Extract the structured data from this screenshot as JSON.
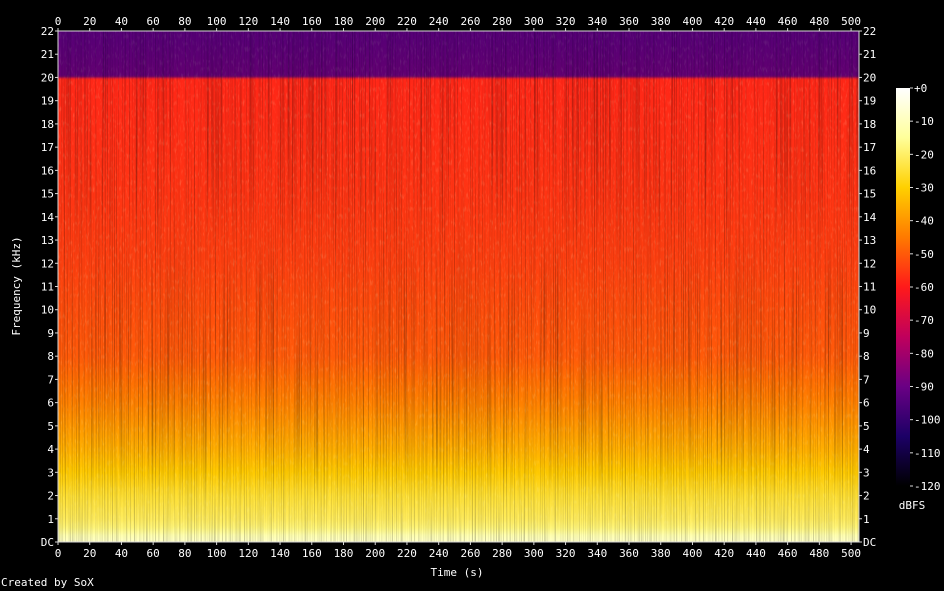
{
  "footer": "Created by SoX",
  "chart_data": {
    "type": "heatmap",
    "title": "",
    "xlabel": "Time (s)",
    "ylabel": "Frequency (kHz)",
    "colorbar_label": "dBFS",
    "xlim": [
      0,
      505
    ],
    "ylim": [
      0,
      22
    ],
    "x_ticks": [
      "0",
      "20",
      "40",
      "60",
      "80",
      "100",
      "120",
      "140",
      "160",
      "180",
      "200",
      "220",
      "240",
      "260",
      "280",
      "300",
      "320",
      "340",
      "360",
      "380",
      "400",
      "420",
      "440",
      "460",
      "480",
      "500"
    ],
    "y_ticks": [
      "DC",
      "1",
      "2",
      "3",
      "4",
      "5",
      "6",
      "7",
      "8",
      "9",
      "10",
      "11",
      "12",
      "13",
      "14",
      "15",
      "16",
      "17",
      "18",
      "19",
      "20",
      "21",
      "22"
    ],
    "colorbar_ticks": [
      "+0",
      "-10",
      "-20",
      "-30",
      "-40",
      "-50",
      "-60",
      "-70",
      "-80",
      "-90",
      "-100",
      "-110",
      "-120"
    ],
    "colorbar_range": [
      -120,
      0
    ],
    "colormap": [
      "#000000",
      "#1c0066",
      "#6a0084",
      "#c0005c",
      "#ff1a1a",
      "#ff7a00",
      "#ffd000",
      "#ffff9a",
      "#ffffff"
    ],
    "level_profile": [
      {
        "freq_khz": 0.0,
        "dbfs": -8
      },
      {
        "freq_khz": 0.3,
        "dbfs": -12
      },
      {
        "freq_khz": 0.6,
        "dbfs": -18
      },
      {
        "freq_khz": 1.0,
        "dbfs": -21
      },
      {
        "freq_khz": 2.0,
        "dbfs": -25
      },
      {
        "freq_khz": 3.0,
        "dbfs": -31
      },
      {
        "freq_khz": 4.0,
        "dbfs": -36
      },
      {
        "freq_khz": 5.0,
        "dbfs": -40
      },
      {
        "freq_khz": 6.0,
        "dbfs": -44
      },
      {
        "freq_khz": 7.0,
        "dbfs": -47
      },
      {
        "freq_khz": 8.0,
        "dbfs": -50
      },
      {
        "freq_khz": 10.0,
        "dbfs": -52
      },
      {
        "freq_khz": 12.0,
        "dbfs": -54
      },
      {
        "freq_khz": 15.0,
        "dbfs": -56
      },
      {
        "freq_khz": 19.9,
        "dbfs": -58
      },
      {
        "freq_khz": 20.1,
        "dbfs": -85
      },
      {
        "freq_khz": 22.0,
        "dbfs": -88
      }
    ],
    "lowpass_cutoff_khz": 20
  }
}
